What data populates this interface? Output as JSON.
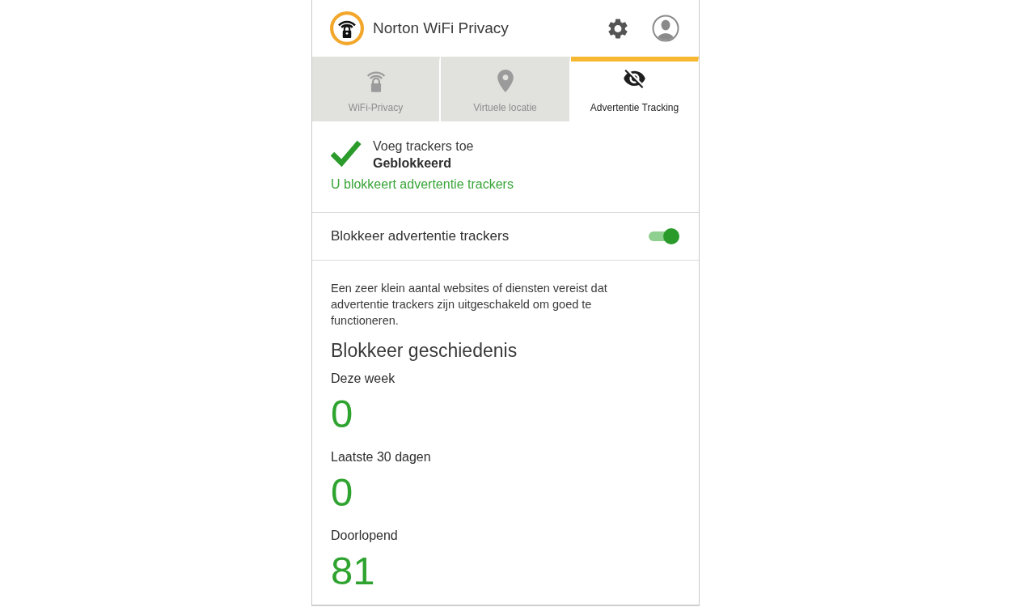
{
  "app": {
    "title": "Norton WiFi Privacy"
  },
  "tabs": [
    {
      "label": "WiFi-Privacy",
      "selected": false
    },
    {
      "label": "Virtuele locatie",
      "selected": false
    },
    {
      "label": "Advertentie Tracking",
      "selected": true
    }
  ],
  "status": {
    "blocked": true,
    "title": "Voeg trackers toe",
    "state": "Geblokkeerd",
    "message": "U blokkeert advertentie trackers"
  },
  "setting": {
    "label": "Blokkeer advertentie trackers",
    "on": true
  },
  "description": "Een zeer klein aantal websites of diensten vereist dat advertentie trackers zijn uitgeschakeld om goed te functioneren.",
  "history": {
    "title": "Blokkeer geschiedenis",
    "stats": [
      {
        "label": "Deze week",
        "value": "0"
      },
      {
        "label": "Laatste 30 dagen",
        "value": "0"
      },
      {
        "label": "Doorlopend",
        "value": "81"
      }
    ]
  }
}
